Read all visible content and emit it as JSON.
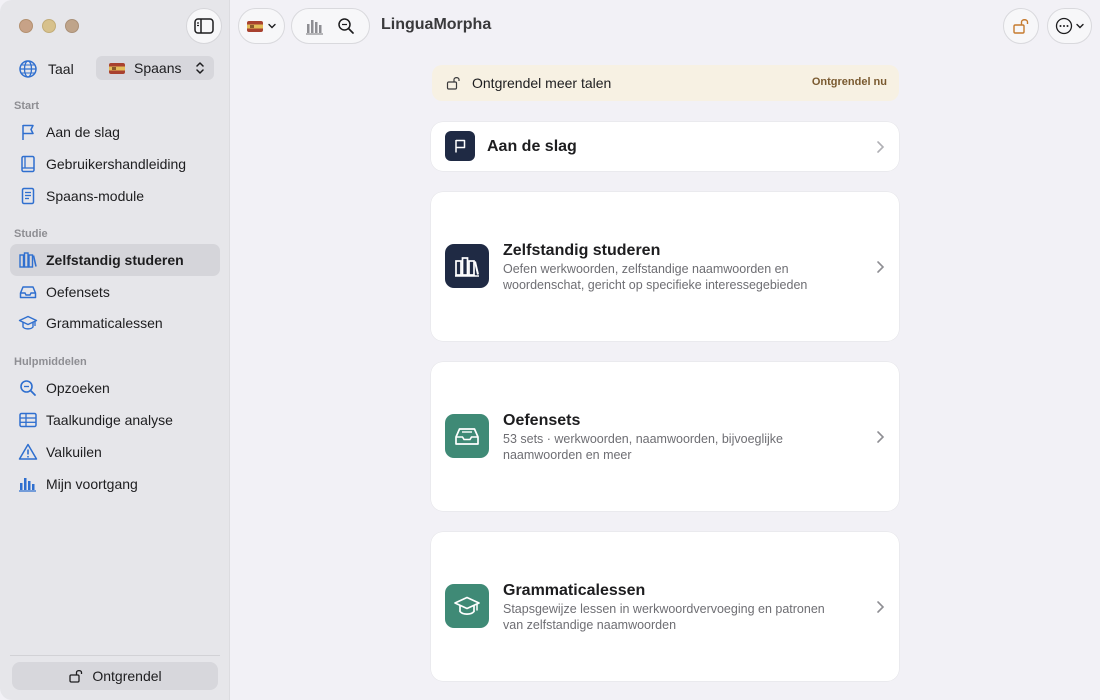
{
  "window": {
    "traffic_lights": [
      "close",
      "minimize",
      "maximize"
    ]
  },
  "toolbar": {
    "app_title": "LinguaMorpha",
    "flag_icon": "spain-flag-icon",
    "chart_icon": "bar-chart-icon",
    "search_icon": "search-icon",
    "lock_icon": "lock-open-icon",
    "more_icon": "ellipsis-circle-icon"
  },
  "sidebar": {
    "language_label": "Taal",
    "language_value": "Spaans",
    "sections": {
      "start": "Start",
      "study": "Studie",
      "tools": "Hulpmiddelen"
    },
    "start_items": [
      {
        "label": "Aan de slag",
        "icon": "flag-icon"
      },
      {
        "label": "Gebruikershandleiding",
        "icon": "book-icon"
      },
      {
        "label": "Spaans-module",
        "icon": "document-icon"
      }
    ],
    "study_items": [
      {
        "label": "Zelfstandig studeren",
        "icon": "books-icon",
        "active": true
      },
      {
        "label": "Oefensets",
        "icon": "tray-icon"
      },
      {
        "label": "Grammaticalessen",
        "icon": "graduation-cap-icon"
      }
    ],
    "tool_items": [
      {
        "label": "Opzoeken",
        "icon": "magnifier-icon"
      },
      {
        "label": "Taalkundige analyse",
        "icon": "table-icon"
      },
      {
        "label": "Valkuilen",
        "icon": "warning-icon"
      },
      {
        "label": "Mijn voortgang",
        "icon": "bar-chart-icon"
      }
    ],
    "unlock_label": "Ontgrendel"
  },
  "main": {
    "banner": {
      "text": "Ontgrendel meer talen",
      "link": "Ontgrendel nu"
    },
    "getting_started": {
      "title": "Aan de slag"
    },
    "cards": [
      {
        "title": "Zelfstandig studeren",
        "description": "Oefen werkwoorden, zelfstandige naamwoorden en woordenschat, gericht op specifieke interessegebieden",
        "tile_color": "#1f2a44"
      },
      {
        "title": "Oefensets",
        "description": "53 sets · werkwoorden, naamwoorden, bijvoeglijke naamwoorden en meer",
        "tile_color": "#3f8a76"
      },
      {
        "title": "Grammaticalessen",
        "description": "Stapsgewijze lessen in werkwoordvervoeging en patronen van zelfstandige naamwoorden",
        "tile_color": "#3f8a76"
      }
    ]
  },
  "colors": {
    "accent": "#2f6fcf",
    "sidebar_bg": "#e6e6ea",
    "main_bg": "#f2f1f6",
    "banner_bg": "#f7f1e3"
  }
}
